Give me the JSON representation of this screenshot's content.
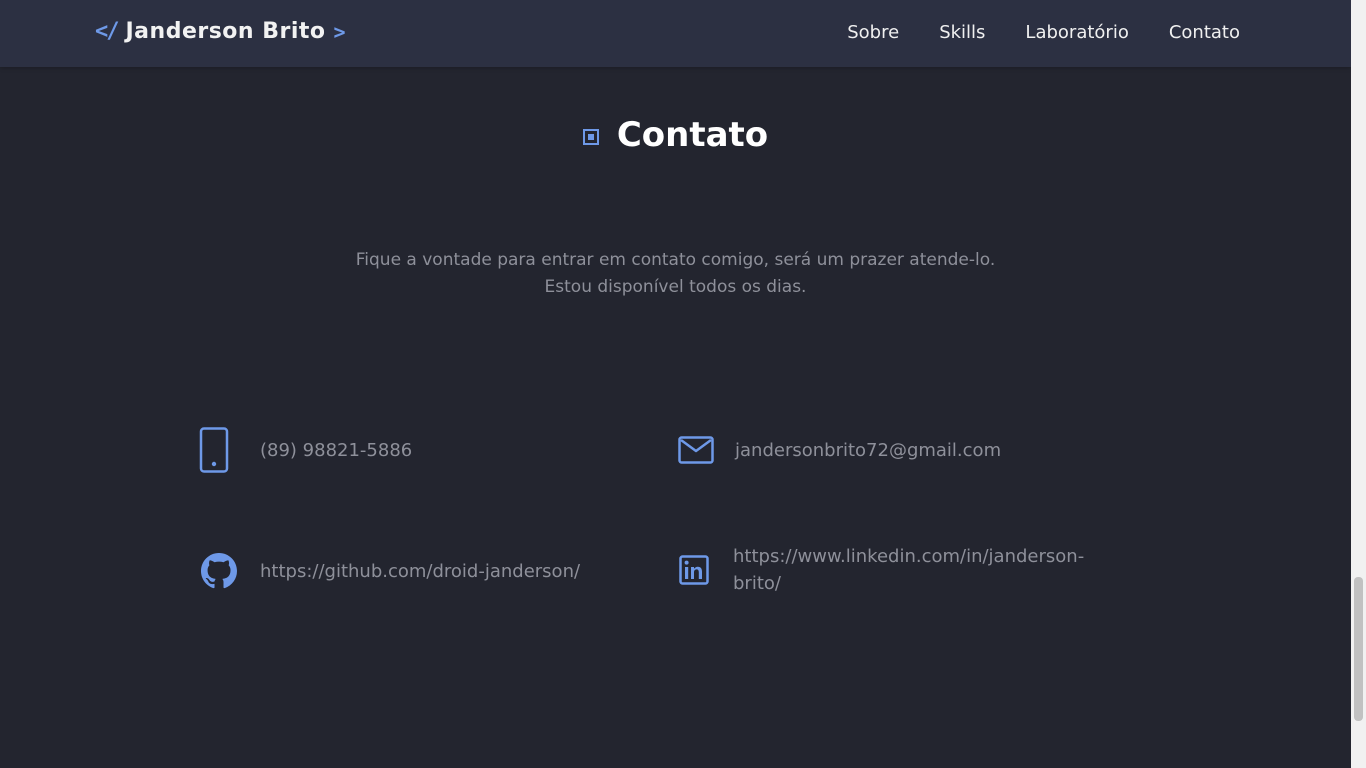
{
  "navbar": {
    "brand_code": "</",
    "brand_name": "Janderson Brito",
    "brand_caret": ">",
    "links": [
      {
        "label": "Sobre"
      },
      {
        "label": "Skills"
      },
      {
        "label": "Laboratório"
      },
      {
        "label": "Contato"
      }
    ]
  },
  "section": {
    "title": "Contato",
    "intro_line1": "Fique a vontade para entrar em contato comigo, será um prazer atende-lo.",
    "intro_line2": "Estou disponível todos os dias."
  },
  "contacts": {
    "phone": {
      "icon": "phone-icon",
      "text": "(89) 98821-5886"
    },
    "email": {
      "icon": "mail-icon",
      "text": "jandersonbrito72@gmail.com"
    },
    "github": {
      "icon": "github-icon",
      "text": "https://github.com/droid-janderson/"
    },
    "linkedin": {
      "icon": "linkedin-icon",
      "text": "https://www.linkedin.com/in/janderson-brito/"
    }
  },
  "colors": {
    "background": "#23252f",
    "navbar": "#2c3042",
    "accent": "#6e99e8",
    "muted_text": "#8e909a"
  }
}
